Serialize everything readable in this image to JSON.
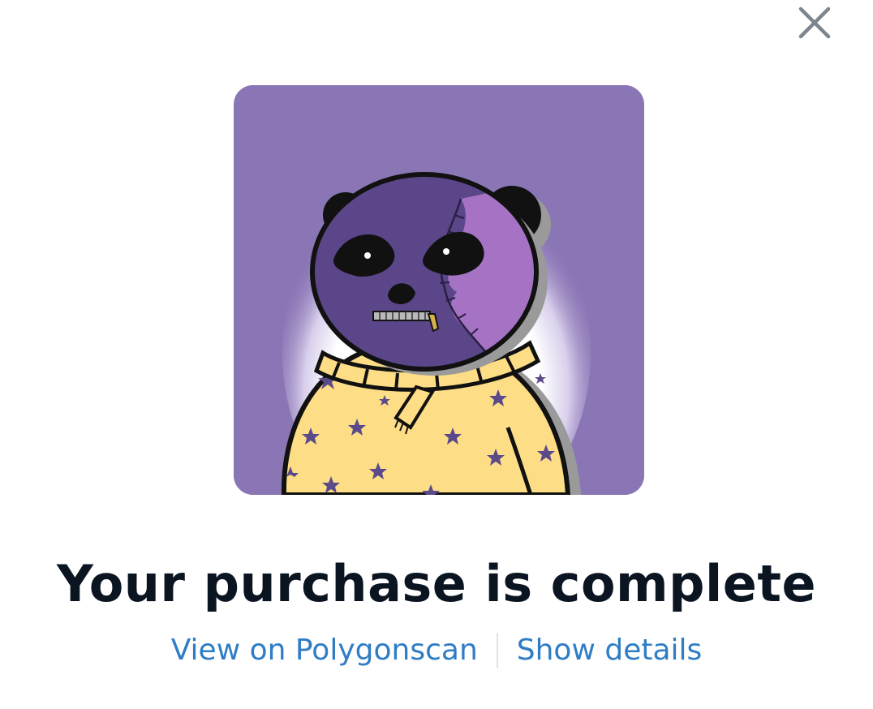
{
  "modal": {
    "close_icon": "close-icon",
    "image_alt": "panda NFT with purple face and yellow star sweater",
    "title": "Your purchase is complete",
    "links": {
      "polygonscan": "View on Polygonscan",
      "details": "Show details"
    }
  },
  "colors": {
    "background": "#ffffff",
    "title_text": "#0b1522",
    "link_text": "#2f7dc4",
    "divider": "#e0e3e8",
    "close_icon": "#7d858f",
    "nft_background": "#8b76b5"
  }
}
